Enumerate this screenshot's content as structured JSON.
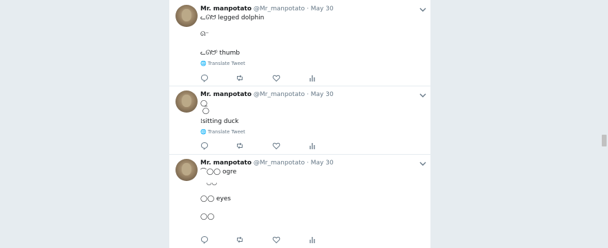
{
  "tweets": [
    {
      "name": "Mr. manpotato",
      "handle": "@Mr_manpotato",
      "dot": "·",
      "date": "May 30",
      "lines": [
        "ᓚᘏᗢ legged dolphin",
        "ᘏ⁻",
        "",
        "ᓚᘏᗢ⁾ thumb"
      ],
      "translate": "Translate Tweet"
    },
    {
      "name": "Mr. manpotato",
      "handle": "@Mr_manpotato",
      "dot": "·",
      "date": "May 30",
      "lines": [
        "◯̲",
        " ◯",
        "⁞sitting duck"
      ],
      "translate": "Translate Tweet"
    },
    {
      "name": "Mr. manpotato",
      "handle": "@Mr_manpotato",
      "dot": "·",
      "date": "May 30",
      "lines": [
        "⌒◯◯ ogre",
        "   ◡◡",
        "",
        "◯◯ eyes",
        "",
        "◯◯"
      ],
      "translate": ""
    }
  ],
  "icons": {
    "reply": "reply-icon",
    "retweet": "retweet-icon",
    "like": "like-icon",
    "analytics": "analytics-icon",
    "caret": "chevron-down-icon",
    "globe": "globe-icon"
  },
  "colors": {
    "background": "#e6ecf0",
    "card": "#ffffff",
    "muted": "#657786",
    "text": "#14171a"
  }
}
